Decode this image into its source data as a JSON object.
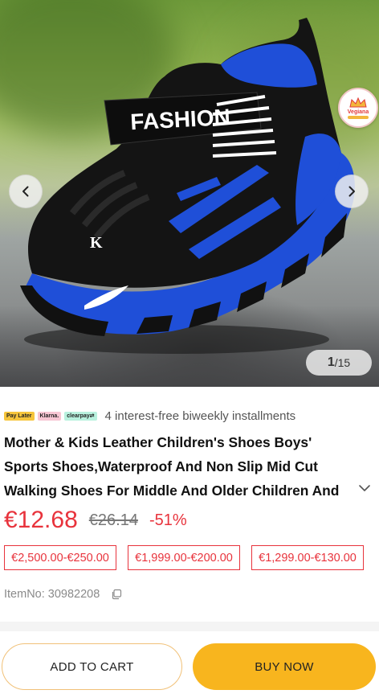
{
  "gallery": {
    "current": "1",
    "total": "/15",
    "shoe_text": "FASHION",
    "shoe_side_text": "K",
    "badge_name": "Vegiana"
  },
  "installments": {
    "badges": [
      "Pay Later",
      "Klarna.",
      "clearpay⇄"
    ],
    "text": "4 interest-free biweekly installments"
  },
  "product": {
    "title": "Mother & Kids Leather Children's Shoes Boys' Sports Shoes,Waterproof And Non Slip Mid Cut Walking Shoes For Middle And Older Children And"
  },
  "price": {
    "current": "€12.68",
    "original": "€26.14",
    "discount": "-51%"
  },
  "tiers": [
    "€2,500.00-€250.00",
    "€1,999.00-€200.00",
    "€1,299.00-€130.00"
  ],
  "item_no": "ItemNo: 30982208",
  "actions": {
    "add_to_cart": "ADD TO CART",
    "buy_now": "BUY NOW"
  },
  "colors": {
    "accent_red": "#e8333c",
    "buy_yellow": "#f8b51e",
    "shoe_blue": "#1f4fd8"
  },
  "icons": {
    "prev": "chevron-left-icon",
    "next": "chevron-right-icon",
    "expand": "chevron-down-icon",
    "copy": "copy-icon"
  }
}
